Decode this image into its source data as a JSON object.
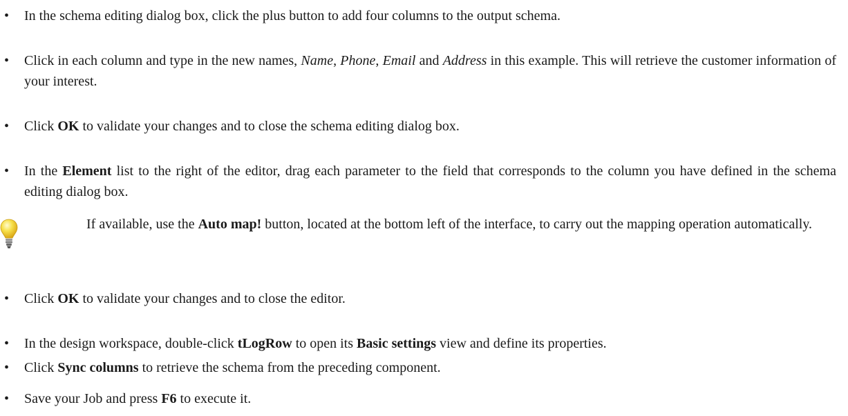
{
  "steps": [
    {
      "parts": [
        {
          "t": "In the schema editing dialog box, click the plus button to add four columns to the output schema."
        }
      ]
    },
    {
      "parts": [
        {
          "t": "Click in each column and type in the new names, "
        },
        {
          "t": "Name",
          "s": "i"
        },
        {
          "t": ", "
        },
        {
          "t": "Phone",
          "s": "i"
        },
        {
          "t": ", "
        },
        {
          "t": "Email",
          "s": "i"
        },
        {
          "t": " and "
        },
        {
          "t": "Address",
          "s": "i"
        },
        {
          "t": " in this example. This will retrieve the customer information of your interest."
        }
      ]
    },
    {
      "parts": [
        {
          "t": "Click "
        },
        {
          "t": "OK",
          "s": "b"
        },
        {
          "t": " to validate your changes and to close the schema editing dialog box."
        }
      ]
    },
    {
      "parts": [
        {
          "t": "In the "
        },
        {
          "t": "Element",
          "s": "b"
        },
        {
          "t": " list to the right of the editor, drag each parameter to the field that corresponds to the column you have defined in the schema editing dialog box."
        }
      ]
    },
    {
      "parts": [
        {
          "t": "Click "
        },
        {
          "t": "OK",
          "s": "b"
        },
        {
          "t": " to validate your changes and to close the editor."
        }
      ]
    },
    {
      "parts": [
        {
          "t": "In the design workspace, double-click "
        },
        {
          "t": "tLogRow",
          "s": "b"
        },
        {
          "t": " to open its "
        },
        {
          "t": "Basic settings",
          "s": "b"
        },
        {
          "t": " view and define its properties."
        }
      ]
    },
    {
      "parts": [
        {
          "t": "Click "
        },
        {
          "t": "Sync columns",
          "s": "b"
        },
        {
          "t": " to retrieve the schema from the preceding component."
        }
      ]
    },
    {
      "parts": [
        {
          "t": "Save your Job and press "
        },
        {
          "t": "F6",
          "s": "b"
        },
        {
          "t": " to execute it."
        }
      ]
    }
  ],
  "tip": {
    "icon": "lightbulb-icon",
    "parts": [
      {
        "t": "If available, use the "
      },
      {
        "t": "Auto map!",
        "s": "b"
      },
      {
        "t": " button, located at the bottom left of the interface, to carry out the mapping operation automatically."
      }
    ]
  },
  "colors": {
    "text": "#1a1a1a",
    "bulb_yellow": "#f2d22e",
    "bulb_base": "#8a8a8a"
  }
}
